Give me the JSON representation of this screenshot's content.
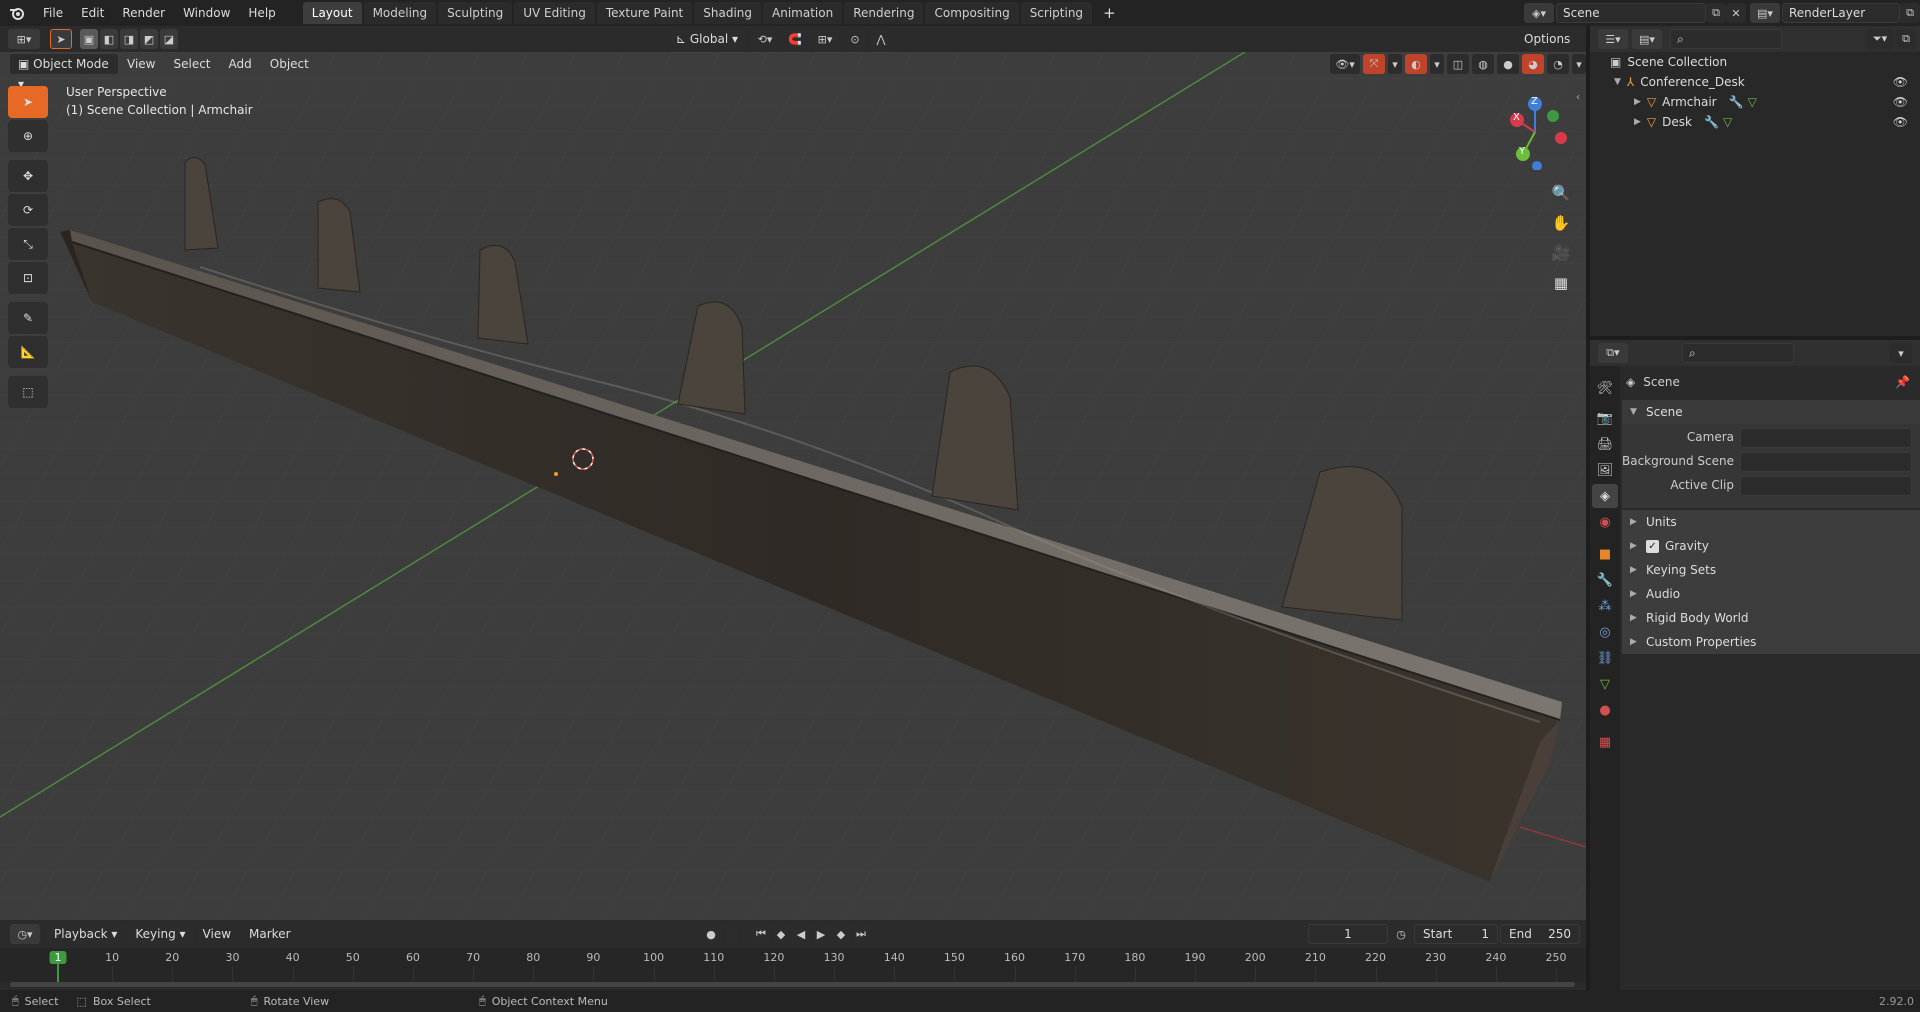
{
  "topbar": {
    "menus": [
      "File",
      "Edit",
      "Render",
      "Window",
      "Help"
    ],
    "workspaces": [
      "Layout",
      "Modeling",
      "Sculpting",
      "UV Editing",
      "Texture Paint",
      "Shading",
      "Animation",
      "Rendering",
      "Compositing",
      "Scripting"
    ],
    "active_workspace": "Layout",
    "add_tab": "+",
    "scene_name": "Scene",
    "view_layer": "RenderLayer"
  },
  "viewport_header": {
    "mode": "Object Mode",
    "menus": [
      "View",
      "Select",
      "Add",
      "Object"
    ],
    "transform_orientation": "Global",
    "options": "Options"
  },
  "viewport": {
    "overlay_line1": "User Perspective",
    "overlay_line2": "(1) Scene Collection | Armchair",
    "gizmo": {
      "x": "X",
      "y": "Y",
      "z": "Z"
    }
  },
  "toolbar": {
    "tools": [
      "select-box-icon",
      "cursor-icon",
      "move-icon",
      "rotate-icon",
      "scale-icon",
      "transform-icon",
      "annotate-icon",
      "measure-icon",
      "add-cube-icon"
    ]
  },
  "timeline": {
    "menus": [
      "Playback",
      "Keying",
      "View",
      "Marker"
    ],
    "current_frame": "1",
    "start_label": "Start",
    "start": "1",
    "end_label": "End",
    "end": "250",
    "ruler": [
      "1",
      "10",
      "20",
      "30",
      "40",
      "50",
      "60",
      "70",
      "80",
      "90",
      "100",
      "110",
      "120",
      "130",
      "140",
      "150",
      "160",
      "170",
      "180",
      "190",
      "200",
      "210",
      "220",
      "230",
      "240",
      "250"
    ]
  },
  "outliner": {
    "root": "Scene Collection",
    "collection": "Conference_Desk",
    "objects": [
      "Armchair",
      "Desk"
    ]
  },
  "properties": {
    "context": "Scene",
    "panel": "Scene",
    "fields": [
      {
        "label": "Camera",
        "value": ""
      },
      {
        "label": "Background Scene",
        "value": ""
      },
      {
        "label": "Active Clip",
        "value": ""
      }
    ],
    "subpanels": [
      "Units",
      "Gravity",
      "Keying Sets",
      "Audio",
      "Rigid Body World",
      "Custom Properties"
    ],
    "gravity_checked": true
  },
  "statusbar": {
    "select": "Select",
    "box_select": "Box Select",
    "rotate_view": "Rotate View",
    "context_menu": "Object Context Menu",
    "version": "2.92.0"
  },
  "colors": {
    "accent": "#e66a26",
    "x_axis": "#d93a4a",
    "y_axis": "#6bbd3a",
    "z_axis": "#3f80d6",
    "frame_marker": "#3f9a3f"
  }
}
